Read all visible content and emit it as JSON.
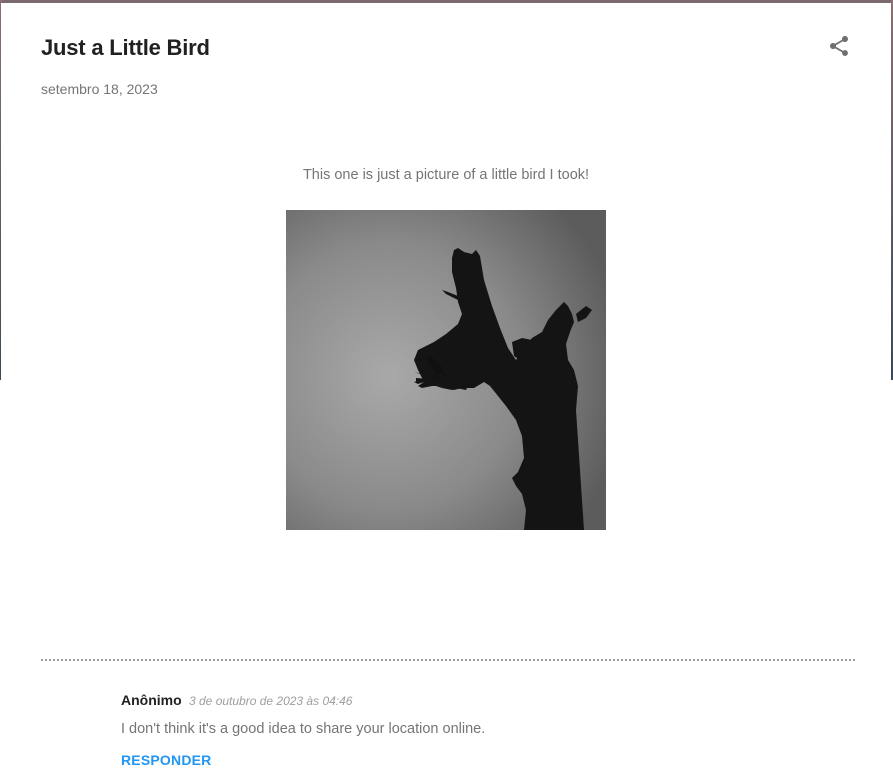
{
  "post": {
    "title": "Just a Little Bird",
    "date": "setembro 18, 2023",
    "body": "This one is just a picture of a little bird I took!"
  },
  "comments": [
    {
      "author": "Anônimo",
      "timestamp": "3 de outubro de 2023 às 04:46",
      "text": "I don't think it's a good idea to share your location online.",
      "reply_label": "RESPONDER"
    }
  ],
  "icons": {
    "share": "share-icon"
  },
  "colors": {
    "title": "#212121",
    "muted": "#757575",
    "accent": "#2196f3"
  }
}
